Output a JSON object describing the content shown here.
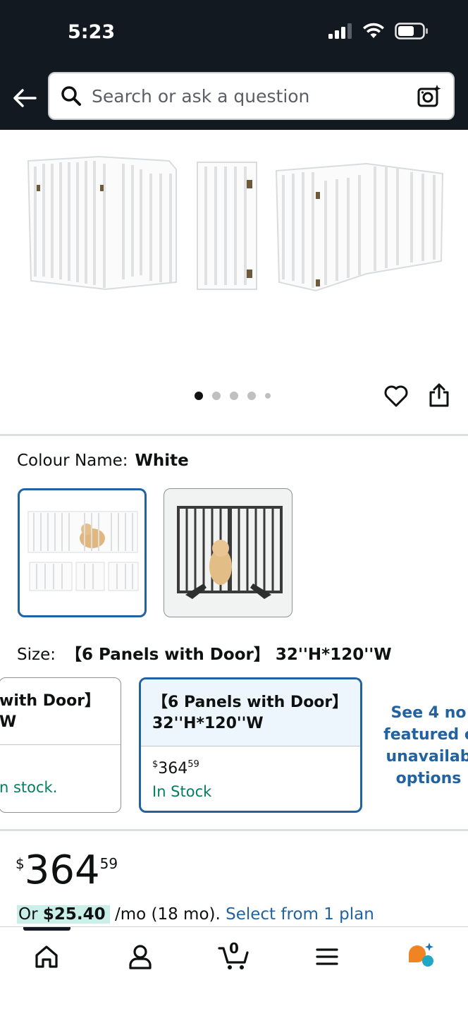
{
  "status_bar": {
    "time": "5:23"
  },
  "search": {
    "placeholder": "Search or ask a question"
  },
  "carousel": {
    "page_count": 5,
    "active_index": 0
  },
  "colour": {
    "label": "Colour Name:",
    "value": "White"
  },
  "size": {
    "label": "Size:",
    "value": "【6 Panels with Door】 32''H*120''W",
    "options": [
      {
        "line1": "with Door】",
        "line2": "W",
        "price_symbol": "",
        "price_whole": "",
        "price_frac": "",
        "stock": "n stock."
      },
      {
        "line1": "【6 Panels with Door】",
        "line2": "32''H*120''W",
        "price_symbol": "$",
        "price_whole": "364",
        "price_frac": "59",
        "stock": "In Stock"
      }
    ],
    "see_more": [
      "See 4 no",
      "featured c",
      "unavailab",
      "options"
    ]
  },
  "price": {
    "symbol": "$",
    "whole": "364",
    "fraction": "59"
  },
  "installment": {
    "prefix": "Or ",
    "amount": "$25.40",
    "term": " /mo (18 mo). ",
    "link": "Select from 1 plan"
  },
  "bottom_nav": {
    "cart_count": "0",
    "items": [
      "home-icon",
      "account-icon",
      "cart-icon",
      "menu-icon",
      "assistant-icon"
    ]
  },
  "colors": {
    "header_bg": "#131921",
    "link": "#2162a1",
    "stock": "#067d62",
    "selected_border": "#2162a1"
  }
}
